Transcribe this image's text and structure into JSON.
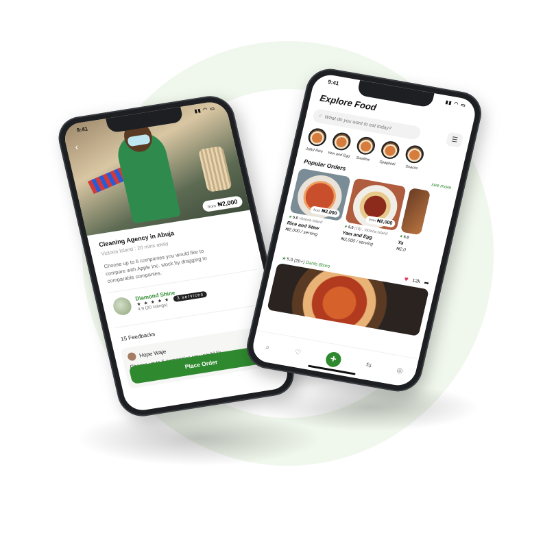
{
  "left_phone": {
    "status_time": "9:41",
    "price_prefix": "from",
    "price": "₦2,000",
    "service_title": "Cleaning Agency in Abuja",
    "service_location": "Victoria Island : 20 mins away",
    "service_description": "Choose up to 6 companies you would like to compare with Apple Inc. stock by dragging to comparable companies.",
    "company": {
      "name": "Diamond Shine",
      "stars": "★ ★ ★ ★ ★",
      "services_badge": "3 services",
      "rating_text": "4.9 (20 ratings)"
    },
    "feedbacks_label": "15 Feedbacks",
    "feedback": {
      "user": "Hope Waje",
      "text": "Choose up to 6 companies you would lik"
    },
    "place_order_label": "Place Order"
  },
  "right_phone": {
    "status_time": "9:41",
    "title": "Explore Food",
    "search_placeholder": "What do you want to eat today?",
    "categories": [
      "Jollof Rice",
      "Yam and Egg",
      "Swallow",
      "Spaghetti",
      "Snacks"
    ],
    "popular_title": "Popular Orders",
    "see_more": "see more",
    "orders": [
      {
        "price_prefix": "from",
        "price": "₦2,000",
        "rating": "5.0",
        "location": "Victoria Island",
        "name": "Rice and Stew",
        "per_serving": "₦2,000 / serving"
      },
      {
        "price_prefix": "from",
        "price": "₦2,000",
        "rating": "5.0",
        "location": "(18) . Victoria Island",
        "name": "Yam and Egg",
        "per_serving": "₦2,000 / serving"
      },
      {
        "price_prefix": "",
        "price": "",
        "rating": "5.0",
        "location": "",
        "name": "Ya",
        "per_serving": "₦2,0"
      }
    ],
    "bistro": {
      "rating": "5.0",
      "reviews": "(20+)",
      "name": "Danfo Bistro",
      "likes": "12k"
    }
  }
}
